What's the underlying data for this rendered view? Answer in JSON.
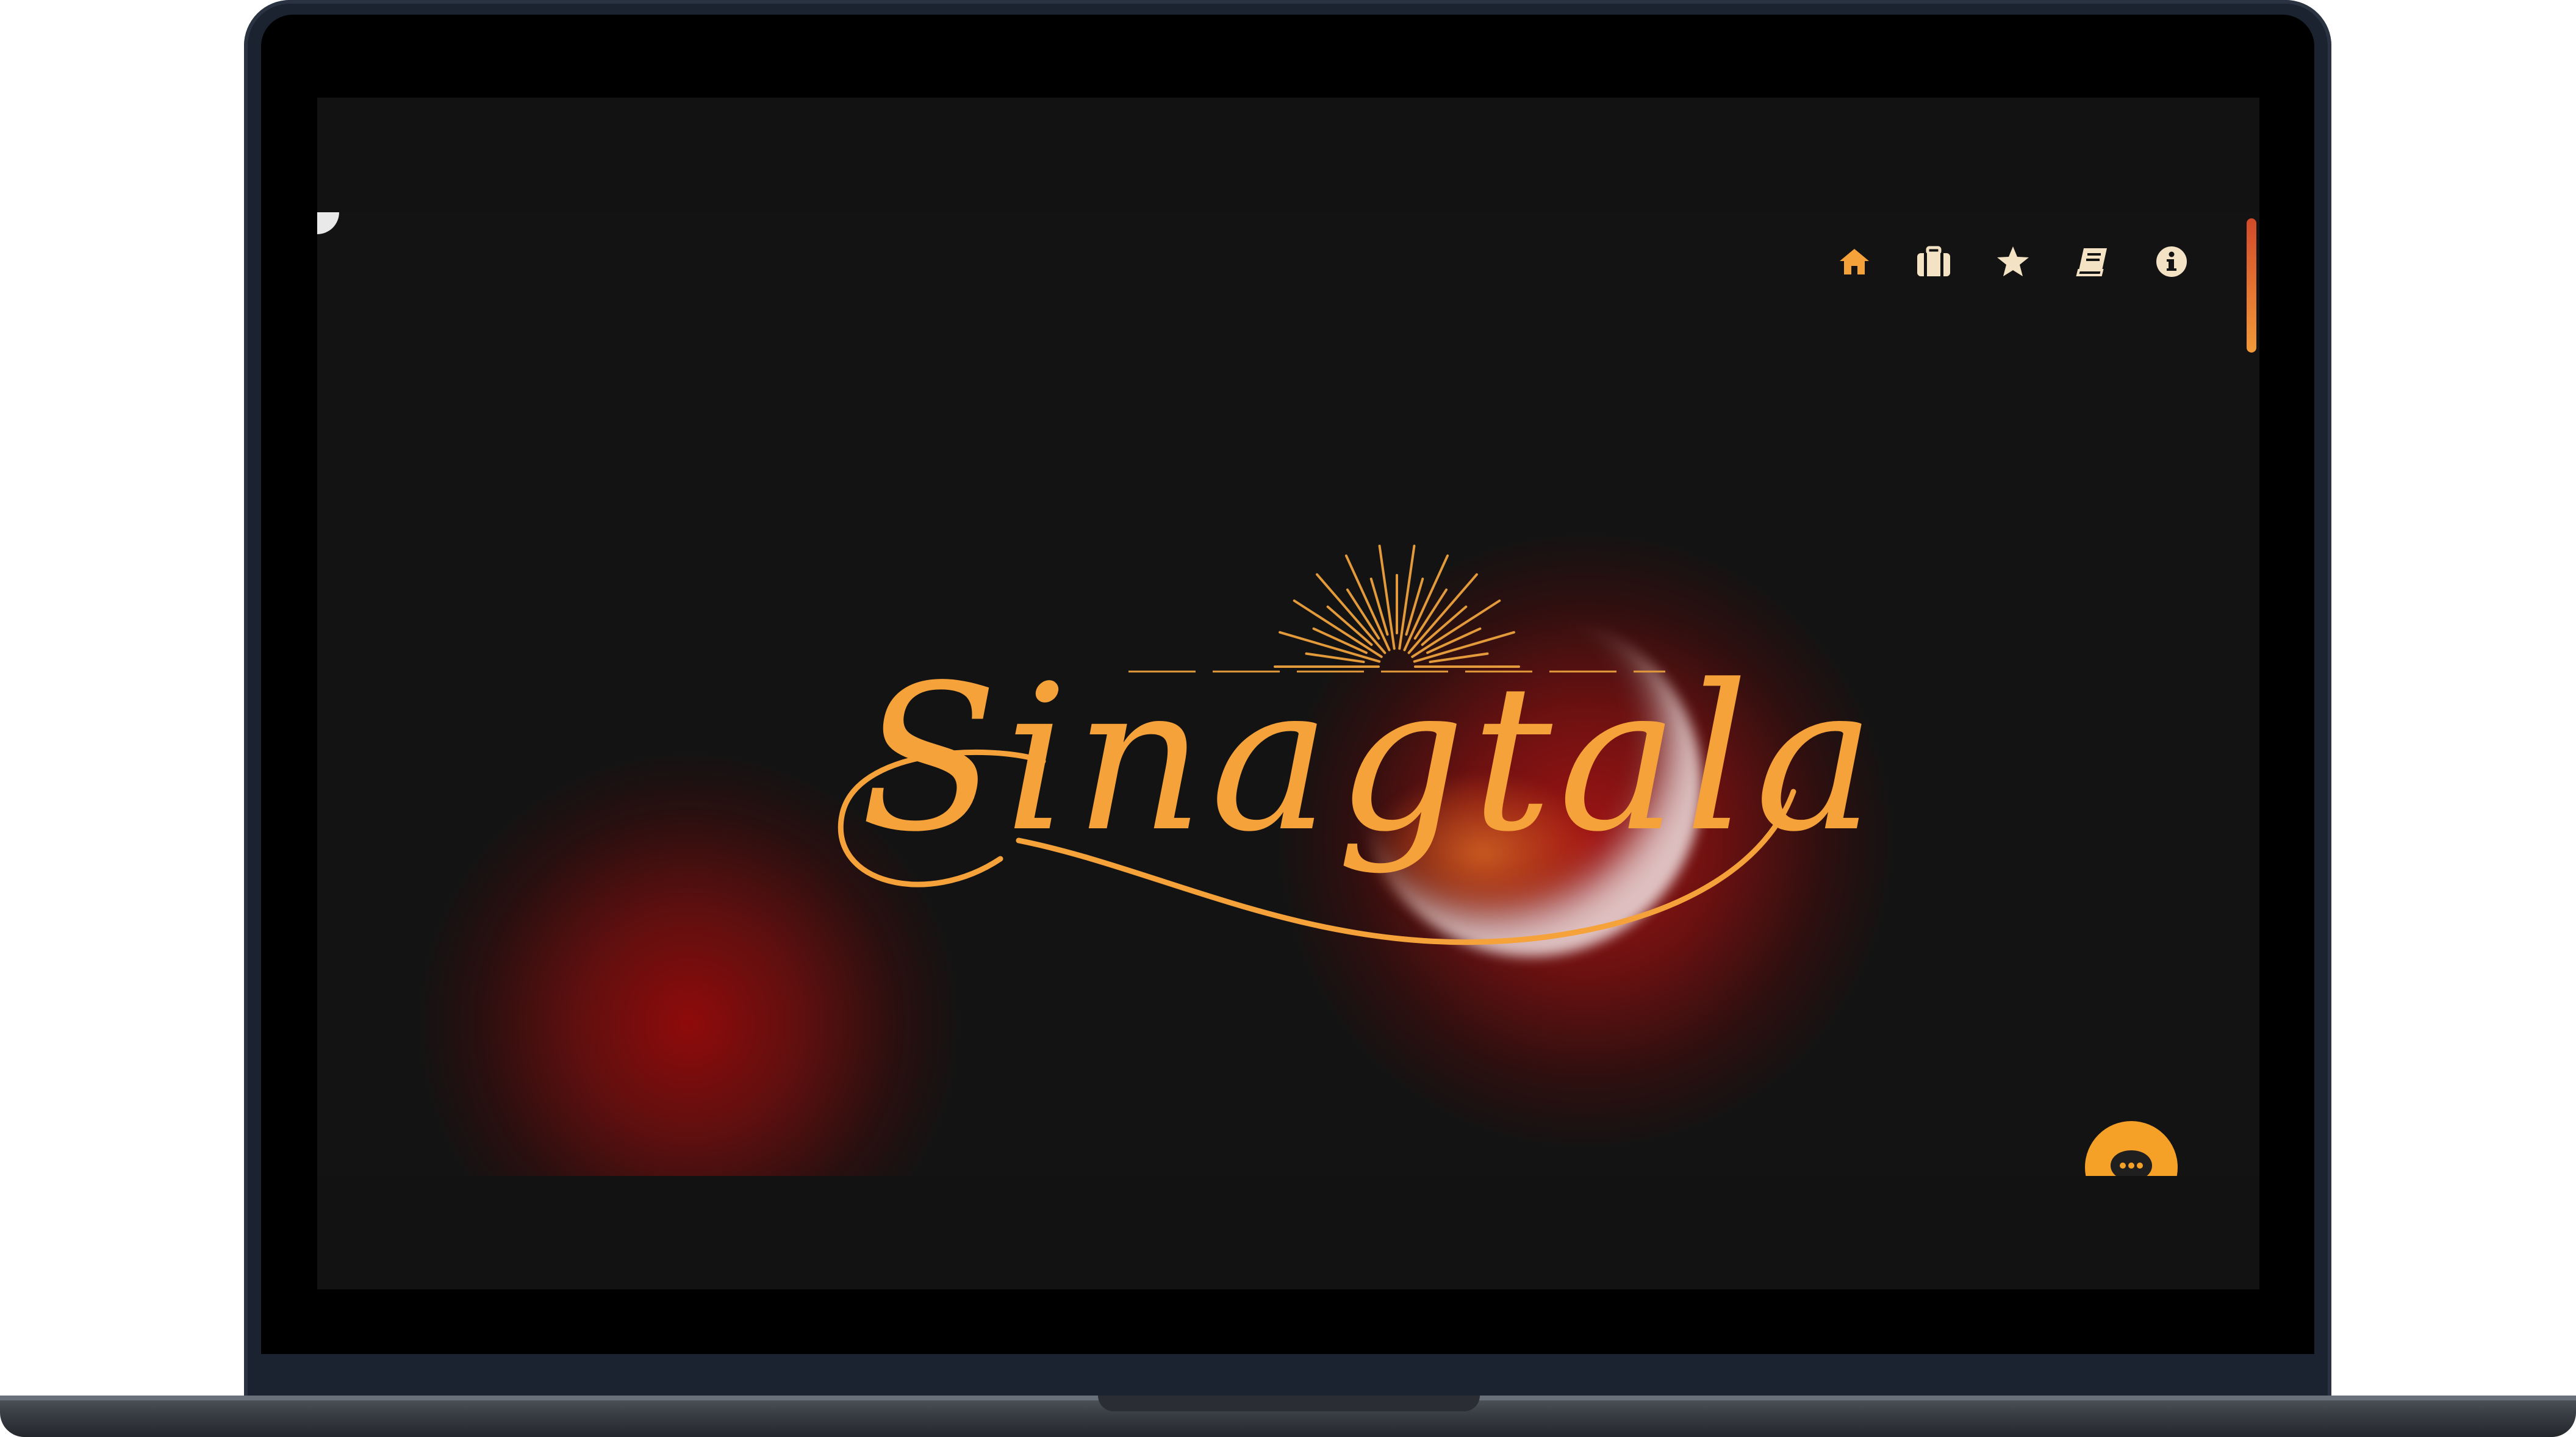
{
  "brand": {
    "logo_text": "Sinagtala",
    "logo_color": "#f5a23a"
  },
  "nav": {
    "items": [
      {
        "id": "home",
        "icon": "home-icon",
        "color": "#f5a23a"
      },
      {
        "id": "portfolio",
        "icon": "briefcase-icon",
        "color": "#f3e3c4"
      },
      {
        "id": "favorites",
        "icon": "star-icon",
        "color": "#f3e3c4"
      },
      {
        "id": "blog",
        "icon": "book-icon",
        "color": "#f3e3c4"
      },
      {
        "id": "about",
        "icon": "info-icon",
        "color": "#f3e3c4"
      }
    ]
  },
  "chat": {
    "icon": "chat-bubble-icon",
    "color": "#f5a027"
  },
  "theme": {
    "background": "#131313",
    "glow_red": "#9e1212",
    "accent": "#f5a23a"
  }
}
